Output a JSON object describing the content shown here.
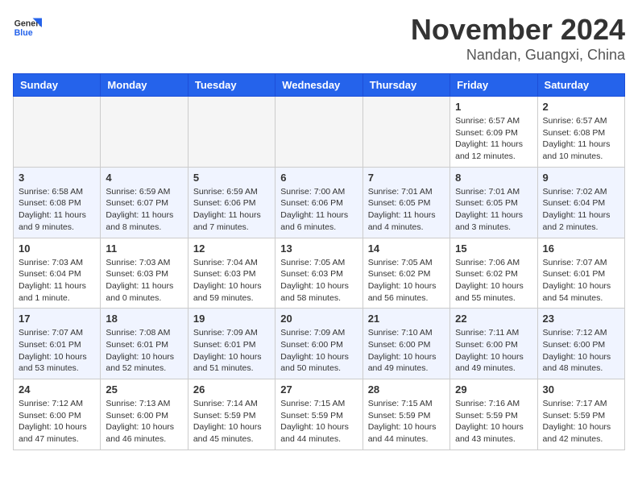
{
  "header": {
    "logo_line1": "General",
    "logo_line2": "Blue",
    "month_title": "November 2024",
    "location": "Nandan, Guangxi, China"
  },
  "weekdays": [
    "Sunday",
    "Monday",
    "Tuesday",
    "Wednesday",
    "Thursday",
    "Friday",
    "Saturday"
  ],
  "weeks": [
    [
      {
        "day": "",
        "info": ""
      },
      {
        "day": "",
        "info": ""
      },
      {
        "day": "",
        "info": ""
      },
      {
        "day": "",
        "info": ""
      },
      {
        "day": "",
        "info": ""
      },
      {
        "day": "1",
        "info": "Sunrise: 6:57 AM\nSunset: 6:09 PM\nDaylight: 11 hours and 12 minutes."
      },
      {
        "day": "2",
        "info": "Sunrise: 6:57 AM\nSunset: 6:08 PM\nDaylight: 11 hours and 10 minutes."
      }
    ],
    [
      {
        "day": "3",
        "info": "Sunrise: 6:58 AM\nSunset: 6:08 PM\nDaylight: 11 hours and 9 minutes."
      },
      {
        "day": "4",
        "info": "Sunrise: 6:59 AM\nSunset: 6:07 PM\nDaylight: 11 hours and 8 minutes."
      },
      {
        "day": "5",
        "info": "Sunrise: 6:59 AM\nSunset: 6:06 PM\nDaylight: 11 hours and 7 minutes."
      },
      {
        "day": "6",
        "info": "Sunrise: 7:00 AM\nSunset: 6:06 PM\nDaylight: 11 hours and 6 minutes."
      },
      {
        "day": "7",
        "info": "Sunrise: 7:01 AM\nSunset: 6:05 PM\nDaylight: 11 hours and 4 minutes."
      },
      {
        "day": "8",
        "info": "Sunrise: 7:01 AM\nSunset: 6:05 PM\nDaylight: 11 hours and 3 minutes."
      },
      {
        "day": "9",
        "info": "Sunrise: 7:02 AM\nSunset: 6:04 PM\nDaylight: 11 hours and 2 minutes."
      }
    ],
    [
      {
        "day": "10",
        "info": "Sunrise: 7:03 AM\nSunset: 6:04 PM\nDaylight: 11 hours and 1 minute."
      },
      {
        "day": "11",
        "info": "Sunrise: 7:03 AM\nSunset: 6:03 PM\nDaylight: 11 hours and 0 minutes."
      },
      {
        "day": "12",
        "info": "Sunrise: 7:04 AM\nSunset: 6:03 PM\nDaylight: 10 hours and 59 minutes."
      },
      {
        "day": "13",
        "info": "Sunrise: 7:05 AM\nSunset: 6:03 PM\nDaylight: 10 hours and 58 minutes."
      },
      {
        "day": "14",
        "info": "Sunrise: 7:05 AM\nSunset: 6:02 PM\nDaylight: 10 hours and 56 minutes."
      },
      {
        "day": "15",
        "info": "Sunrise: 7:06 AM\nSunset: 6:02 PM\nDaylight: 10 hours and 55 minutes."
      },
      {
        "day": "16",
        "info": "Sunrise: 7:07 AM\nSunset: 6:01 PM\nDaylight: 10 hours and 54 minutes."
      }
    ],
    [
      {
        "day": "17",
        "info": "Sunrise: 7:07 AM\nSunset: 6:01 PM\nDaylight: 10 hours and 53 minutes."
      },
      {
        "day": "18",
        "info": "Sunrise: 7:08 AM\nSunset: 6:01 PM\nDaylight: 10 hours and 52 minutes."
      },
      {
        "day": "19",
        "info": "Sunrise: 7:09 AM\nSunset: 6:01 PM\nDaylight: 10 hours and 51 minutes."
      },
      {
        "day": "20",
        "info": "Sunrise: 7:09 AM\nSunset: 6:00 PM\nDaylight: 10 hours and 50 minutes."
      },
      {
        "day": "21",
        "info": "Sunrise: 7:10 AM\nSunset: 6:00 PM\nDaylight: 10 hours and 49 minutes."
      },
      {
        "day": "22",
        "info": "Sunrise: 7:11 AM\nSunset: 6:00 PM\nDaylight: 10 hours and 49 minutes."
      },
      {
        "day": "23",
        "info": "Sunrise: 7:12 AM\nSunset: 6:00 PM\nDaylight: 10 hours and 48 minutes."
      }
    ],
    [
      {
        "day": "24",
        "info": "Sunrise: 7:12 AM\nSunset: 6:00 PM\nDaylight: 10 hours and 47 minutes."
      },
      {
        "day": "25",
        "info": "Sunrise: 7:13 AM\nSunset: 6:00 PM\nDaylight: 10 hours and 46 minutes."
      },
      {
        "day": "26",
        "info": "Sunrise: 7:14 AM\nSunset: 5:59 PM\nDaylight: 10 hours and 45 minutes."
      },
      {
        "day": "27",
        "info": "Sunrise: 7:15 AM\nSunset: 5:59 PM\nDaylight: 10 hours and 44 minutes."
      },
      {
        "day": "28",
        "info": "Sunrise: 7:15 AM\nSunset: 5:59 PM\nDaylight: 10 hours and 44 minutes."
      },
      {
        "day": "29",
        "info": "Sunrise: 7:16 AM\nSunset: 5:59 PM\nDaylight: 10 hours and 43 minutes."
      },
      {
        "day": "30",
        "info": "Sunrise: 7:17 AM\nSunset: 5:59 PM\nDaylight: 10 hours and 42 minutes."
      }
    ]
  ]
}
